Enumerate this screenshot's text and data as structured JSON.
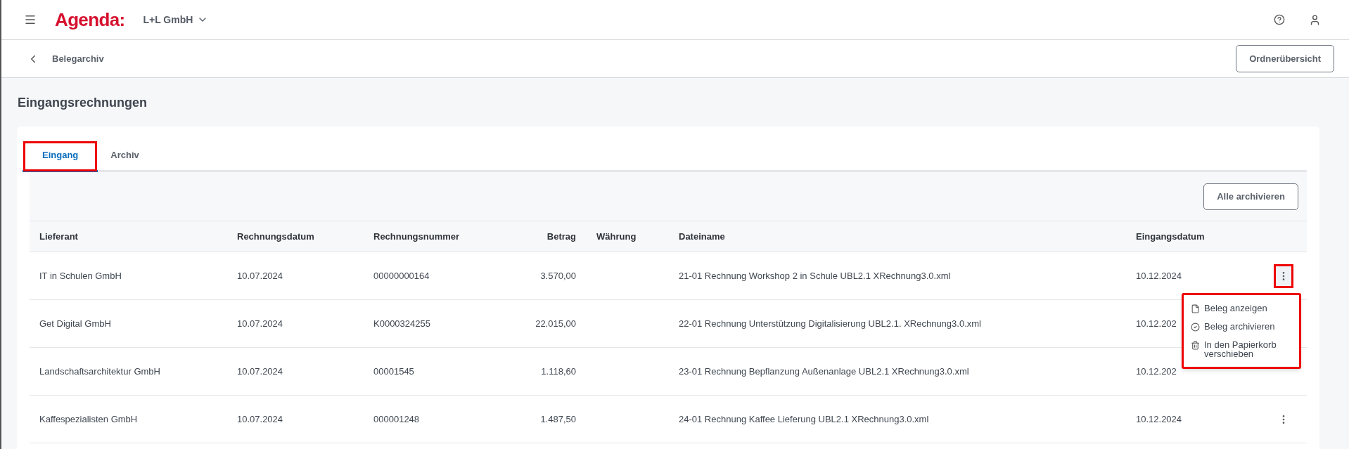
{
  "topbar": {
    "brand": "Agenda:",
    "company": "L+L GmbH"
  },
  "subbar": {
    "title": "Belegarchiv",
    "button": "Ordnerübersicht"
  },
  "page_title": "Eingangsrechnungen",
  "tabs": [
    {
      "label": "Eingang",
      "selected": true,
      "highlighted": true
    },
    {
      "label": "Archiv",
      "selected": false,
      "highlighted": false
    }
  ],
  "toolbar": {
    "button": "Alle archivieren"
  },
  "table": {
    "columns": [
      "Lieferant",
      "Rechnungsdatum",
      "Rechnungsnummer",
      "Betrag",
      "Währung",
      "Dateiname",
      "Eingangsdatum"
    ],
    "rows": [
      {
        "cells": [
          "IT in Schulen GmbH",
          "10.07.2024",
          "00000000164",
          "3.570,00",
          "",
          "21-01 Rechnung Workshop 2 in Schule UBL2.1 XRechnung3.0.xml",
          "10.12.2024"
        ],
        "actions": {
          "menu_open": true,
          "highlighted": true
        }
      },
      {
        "cells": [
          "Get Digital GmbH",
          "10.07.2024",
          "K0000324255",
          "22.015,00",
          "",
          "22-01 Rechnung Unterstützung Digitalisierung UBL2.1. XRechnung3.0.xml",
          "10.12.202"
        ]
      },
      {
        "cells": [
          "Landschaftsarchitektur GmbH",
          "10.07.2024",
          "00001545",
          "1.118,60",
          "",
          "23-01 Rechnung Bepflanzung Außenanlage UBL2.1 XRechnung3.0.xml",
          "10.12.202"
        ]
      },
      {
        "cells": [
          "Kaffespezialisten GmbH",
          "10.07.2024",
          "000001248",
          "1.487,50",
          "",
          "24-01 Rechnung Kaffee Lieferung UBL2.1 XRechnung3.0.xml",
          "10.12.2024"
        ],
        "actions": {
          "menu_open": false,
          "highlighted": false
        }
      }
    ]
  },
  "menu": {
    "highlighted": true,
    "items": [
      {
        "kind": "file",
        "label": "Beleg anzeigen"
      },
      {
        "kind": "check",
        "label": "Beleg archivieren"
      },
      {
        "kind": "trash",
        "label": "In den Papierkorb verschieben"
      }
    ]
  }
}
